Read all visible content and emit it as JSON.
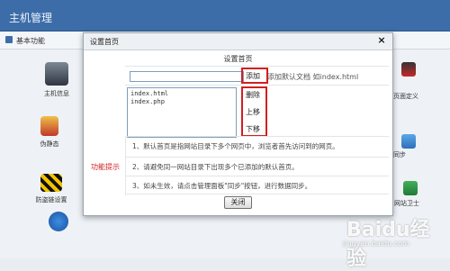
{
  "app": {
    "title": "主机管理"
  },
  "subnav": {
    "label": "基本功能"
  },
  "tiles": {
    "host_info": "主机信息",
    "pseudo_static": "伪静态",
    "anti_leech": "防盗链设置",
    "custom_page": "页面定义",
    "sync": "同步",
    "guard": "网站卫士"
  },
  "dialog": {
    "title": "设置首页",
    "close_glyph": "×",
    "section_title": "设置首页",
    "input_value": "",
    "add_button": "添加",
    "add_hint": "添加默认文档 如index.html",
    "default_docs": [
      "index.html",
      "index.php"
    ],
    "delete_button": "删除",
    "move_up_button": "上移",
    "move_down_button": "下移",
    "tip_label": "功能提示",
    "tips": [
      "1、默认首页是指网站目录下多个网页中，浏览者首先访问到的网页。",
      "2、请避免同一网站目录下出现多个已添加的默认首页。",
      "3、如未生效，请点击管理面板\"同步\"按钮，进行数据同步。"
    ],
    "close_button": "关闭"
  },
  "watermark": {
    "brand": "Baidu经验",
    "url": "jingyan.baidu.com"
  }
}
